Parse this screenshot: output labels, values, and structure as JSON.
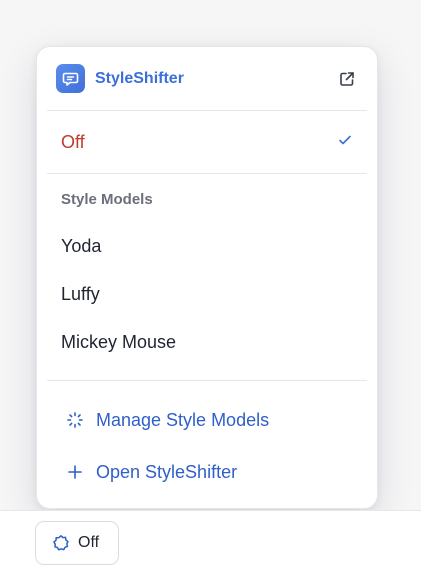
{
  "popover": {
    "app_name": "StyleShifter",
    "off_label": "Off",
    "section_heading": "Style Models",
    "models": [
      "Yoda",
      "Luffy",
      "Mickey Mouse"
    ],
    "actions": {
      "manage": "Manage Style Models",
      "open": "Open StyleShifter"
    }
  },
  "status_button": {
    "label": "Off"
  },
  "icons": {
    "logo": "chat-bubble-icon",
    "external": "external-link-icon",
    "selected": "checkmark-icon",
    "manage": "loading-spinner-icon",
    "open": "plus-icon",
    "status": "sparkle-badge-icon"
  },
  "colors": {
    "accent": "#3b6fd9",
    "link": "#2f5fc9",
    "off": "#c0392b",
    "heading": "#6b6f7a"
  }
}
